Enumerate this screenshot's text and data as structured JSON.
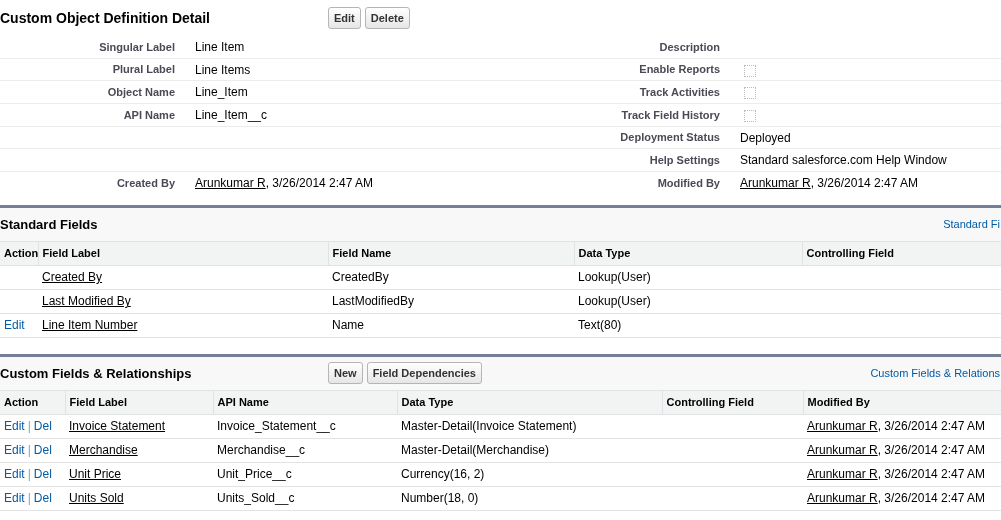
{
  "detail": {
    "title": "Custom Object Definition Detail",
    "buttons": [
      "Edit",
      "Delete"
    ],
    "rows": [
      {
        "left": {
          "label": "Singular Label",
          "kind": "text",
          "value": "Line Item"
        },
        "right": {
          "label": "Description",
          "kind": "empty"
        }
      },
      {
        "left": {
          "label": "Plural Label",
          "kind": "text",
          "value": "Line Items"
        },
        "right": {
          "label": "Enable Reports",
          "kind": "checkbox",
          "checked": false
        }
      },
      {
        "left": {
          "label": "Object Name",
          "kind": "text",
          "value": "Line_Item"
        },
        "right": {
          "label": "Track Activities",
          "kind": "checkbox",
          "checked": false
        }
      },
      {
        "left": {
          "label": "API Name",
          "kind": "text",
          "value": "Line_Item__c"
        },
        "right": {
          "label": "Track Field History",
          "kind": "checkbox",
          "checked": false
        }
      },
      {
        "left": {
          "kind": "empty"
        },
        "right": {
          "label": "Deployment Status",
          "kind": "text",
          "value": "Deployed"
        }
      },
      {
        "left": {
          "kind": "empty"
        },
        "right": {
          "label": "Help Settings",
          "kind": "text",
          "value": "Standard salesforce.com Help Window"
        }
      },
      {
        "left": {
          "label": "Created By",
          "kind": "user",
          "user": "Arunkumar R",
          "date": ", 3/26/2014 2:47 AM"
        },
        "right": {
          "label": "Modified By",
          "kind": "user",
          "user": "Arunkumar R",
          "date": ", 3/26/2014 2:47 AM"
        }
      }
    ]
  },
  "standard_fields": {
    "title": "Standard Fields",
    "help_link": "Standard Fi",
    "columns": [
      "Action",
      "Field Label",
      "Field Name",
      "Data Type",
      "Controlling Field"
    ],
    "rows": [
      {
        "actions": [],
        "field_label": "Created By",
        "field_name": "CreatedBy",
        "data_type": "Lookup(User)"
      },
      {
        "actions": [],
        "field_label": "Last Modified By",
        "field_name": "LastModifiedBy",
        "data_type": "Lookup(User)"
      },
      {
        "actions": [
          "Edit"
        ],
        "field_label": "Line Item Number",
        "field_name": "Name",
        "data_type": "Text(80)"
      }
    ]
  },
  "custom_fields": {
    "title": "Custom Fields & Relationships",
    "buttons": [
      "New",
      "Field Dependencies"
    ],
    "action_separator": "|",
    "help_link": "Custom Fields & Relations",
    "columns": [
      "Action",
      "Field Label",
      "API Name",
      "Data Type",
      "Controlling Field",
      "Modified By"
    ],
    "rows": [
      {
        "actions": [
          "Edit",
          "Del"
        ],
        "field_label": "Invoice Statement",
        "api_name": "Invoice_Statement__c",
        "data_type": "Master-Detail(Invoice Statement)",
        "modified_user": "Arunkumar R",
        "modified_date": ", 3/26/2014 2:47 AM"
      },
      {
        "actions": [
          "Edit",
          "Del"
        ],
        "field_label": "Merchandise",
        "api_name": "Merchandise__c",
        "data_type": "Master-Detail(Merchandise)",
        "modified_user": "Arunkumar R",
        "modified_date": ", 3/26/2014 2:47 AM"
      },
      {
        "actions": [
          "Edit",
          "Del"
        ],
        "field_label": "Unit Price",
        "api_name": "Unit_Price__c",
        "data_type": "Currency(16, 2)",
        "modified_user": "Arunkumar R",
        "modified_date": ", 3/26/2014 2:47 AM"
      },
      {
        "actions": [
          "Edit",
          "Del"
        ],
        "field_label": "Units Sold",
        "api_name": "Units_Sold__c",
        "data_type": "Number(18, 0)",
        "modified_user": "Arunkumar R",
        "modified_date": ", 3/26/2014 2:47 AM"
      }
    ]
  }
}
